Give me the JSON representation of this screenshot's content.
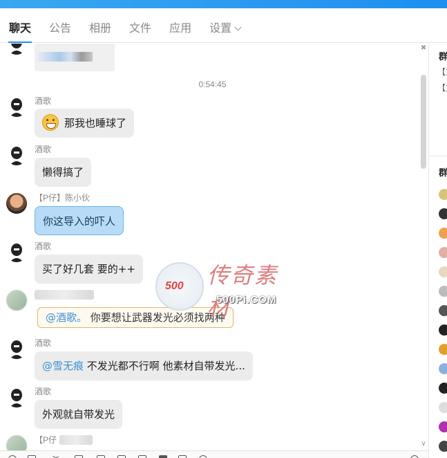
{
  "tabs": [
    {
      "label": "聊天"
    },
    {
      "label": "公告"
    },
    {
      "label": "相册"
    },
    {
      "label": "文件"
    },
    {
      "label": "应用"
    },
    {
      "label": "设置"
    }
  ],
  "chat": {
    "timestamp": "0:54:45",
    "messages": [
      {
        "sender": "酒歌",
        "text": "那我也睡球了",
        "emoji": "grinning-face-icon"
      },
      {
        "sender": "酒歌",
        "text": "懒得搞了"
      },
      {
        "sender": "【P仔】陈小伙",
        "text": "你这导入的吓人"
      },
      {
        "sender": "酒歌",
        "text": "买了好几套 要的++"
      },
      {
        "sender": "",
        "mention": "@酒歌。",
        "text": " 你要想让武器发光必须找两种"
      },
      {
        "sender": "酒歌",
        "mention": "@雪无痕",
        "text": " 不发光都不行啊 他素材自带发光..."
      },
      {
        "sender": "酒歌",
        "text": "外观就自带发光"
      },
      {
        "sender": "【P仔"
      }
    ]
  },
  "watermark": {
    "cn_text": "传奇素材",
    "url": "500Pi.COM",
    "logo": "500"
  },
  "right_panel": {
    "title1": "群",
    "line1": "【文",
    "line2": "【文",
    "title2": "群"
  },
  "colors": {
    "accent": "#1e8ff0",
    "bubble": "#ececec",
    "bubble_blue": "#b8dcf8",
    "mention": "#3a8fd8"
  }
}
